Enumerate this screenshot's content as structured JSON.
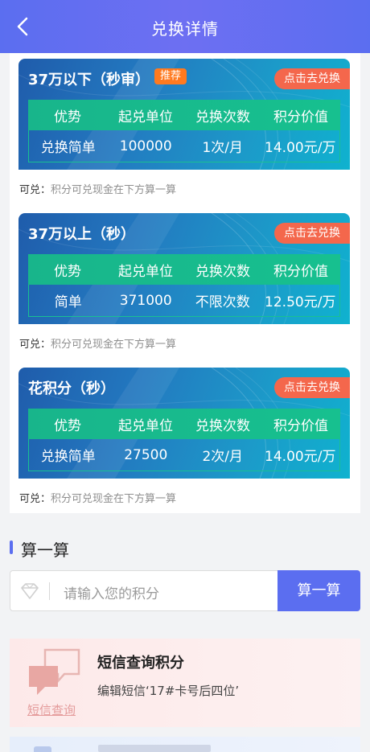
{
  "nav": {
    "title": "兑换详情"
  },
  "cards": [
    {
      "name": "37万以下（秒审）",
      "badge": "推荐",
      "action": "点击去兑换",
      "headers": [
        "优势",
        "起兑单位",
        "兑换次数",
        "积分价值"
      ],
      "values": [
        "兑换简单",
        "100000",
        "1次/月",
        "14.00元/万"
      ],
      "note_label": "可兑：",
      "note_text": "积分可兑现金在下方算一算"
    },
    {
      "name": "37万以上（秒）",
      "badge": "",
      "action": "点击去兑换",
      "headers": [
        "优势",
        "起兑单位",
        "兑换次数",
        "积分价值"
      ],
      "values": [
        "简单",
        "371000",
        "不限次数",
        "12.50元/万"
      ],
      "note_label": "可兑：",
      "note_text": "积分可兑现金在下方算一算"
    },
    {
      "name": "花积分（秒）",
      "badge": "",
      "action": "点击去兑换",
      "headers": [
        "优势",
        "起兑单位",
        "兑换次数",
        "积分价值"
      ],
      "values": [
        "兑换简单",
        "27500",
        "2次/月",
        "14.00元/万"
      ],
      "note_label": "可兑：",
      "note_text": "积分可兑现金在下方算一算"
    }
  ],
  "calc": {
    "title": "算一算",
    "placeholder": "请输入您的积分",
    "button": "算一算"
  },
  "sms": {
    "title": "短信查询积分",
    "desc": "编辑短信‘17#卡号后四位’",
    "link": "短信查询"
  },
  "colors": {
    "accent": "#5b6ef0",
    "table_head": "#18b58b",
    "action": "#f4674c",
    "badge": "#ff7a1f"
  }
}
